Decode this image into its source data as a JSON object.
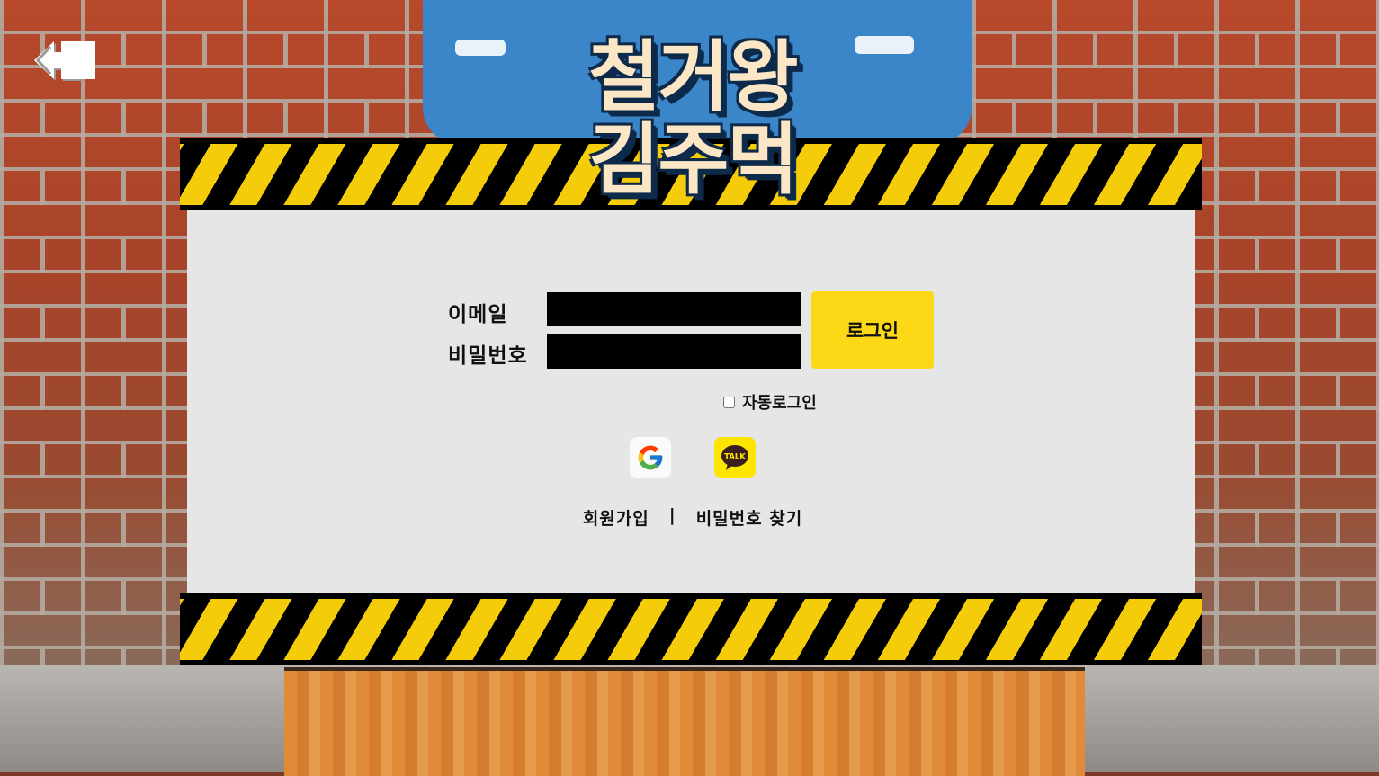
{
  "back": {
    "icon": "back-arrow-icon"
  },
  "title": {
    "line1": "철거왕",
    "line2": "김주먹"
  },
  "form": {
    "email_label": "이메일",
    "password_label": "비밀번호",
    "email_value": "",
    "password_value": "",
    "login_label": "로그인",
    "auto_login_label": "자동로그인",
    "auto_login_checked": false
  },
  "social": {
    "google_icon": "google-icon",
    "kakao_icon": "kakaotalk-icon",
    "kakao_text": "TALK"
  },
  "links": {
    "signup": "회원가입",
    "separator": "|",
    "find_password": "비밀번호 찾기"
  },
  "colors": {
    "accent": "#fcd817",
    "panel": "#e6e6e6",
    "stripe_yellow": "#f5cc0a",
    "kakao": "#fee500"
  }
}
